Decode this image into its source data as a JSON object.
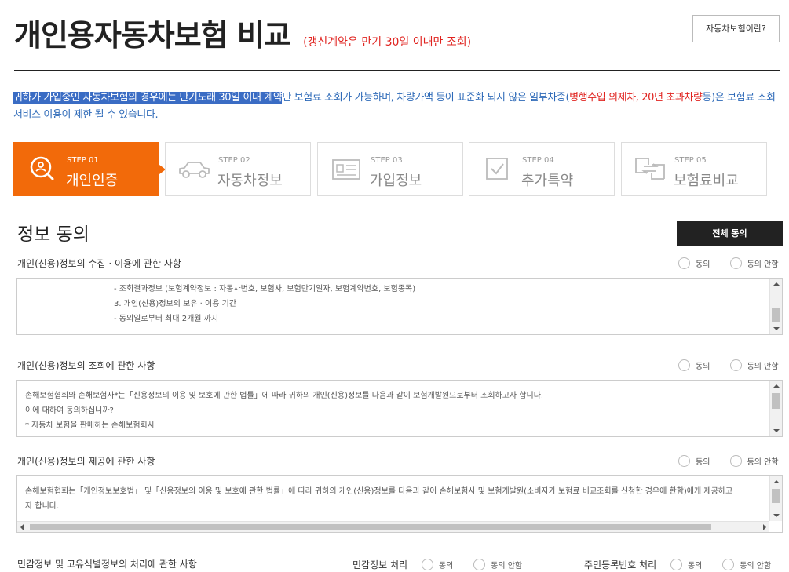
{
  "header": {
    "title": "개인용자동차보험 비교",
    "subtitle": "(갱신계약은 만기 30일 이내만 조회)",
    "about_button": "자동차보험이란?"
  },
  "notice": {
    "highlighted": "귀하가 가입중인 자동차보험의 경우에는 만기도래 30일 이내 계약",
    "part1": "만 보험료 조회가 가능하며, 차량가액 등이 표준화 되지 않은 일부차종(",
    "red": "병행수입 외제차, 20년 초과차량",
    "part2": "등)은 보험료 조회서비스 이용이 제한 될 수 있습니다."
  },
  "steps": [
    {
      "num": "STEP 01",
      "label": "개인인증",
      "icon": "search-person-icon",
      "active": true
    },
    {
      "num": "STEP 02",
      "label": "자동차정보",
      "icon": "car-icon",
      "active": false
    },
    {
      "num": "STEP 03",
      "label": "가입정보",
      "icon": "id-card-icon",
      "active": false
    },
    {
      "num": "STEP 04",
      "label": "추가특약",
      "icon": "checkbox-icon",
      "active": false
    },
    {
      "num": "STEP 05",
      "label": "보험료비교",
      "icon": "compare-arrows-icon",
      "active": false
    }
  ],
  "consent": {
    "title": "정보 동의",
    "agree_all": "전체 동의",
    "agree": "동의",
    "disagree": "동의 안함",
    "sections": [
      {
        "label": "개인(신용)정보의 수집 · 이용에 관한 사항",
        "lines": [
          "- 조회결과정보 (보험계약정보 : 자동차번호, 보험사, 보험만기일자, 보험계약번호, 보험종목)",
          "3. 개인(신용)정보의 보유 · 이용 기간",
          "- 동의일로부터 최대 2개월 까지"
        ]
      },
      {
        "label": "개인(신용)정보의 조회에 관한 사항",
        "lines": [
          "손해보험협회와 손해보험사*는「신용정보의 이용 및 보호에 관한 법률」에 따라 귀하의 개인(신용)정보를 다음과 같이 보험개발원으로부터 조회하고자 합니다.",
          "이에 대하여 동의하십니까?",
          "* 자동차 보험을 판매하는 손해보험회사"
        ]
      },
      {
        "label": "개인(신용)정보의 제공에 관한 사항",
        "lines": [
          "손해보험협회는「개인정보보호법」 및「신용정보의 이용 및 보호에 관한 법률」에 따라 귀하의 개인(신용)정보를 다음과 같이 손해보험사 및 보험개발원(소비자가 보험료 비교조회를 신청한 경우에 한함)에게 제공하고",
          "자 합니다."
        ]
      }
    ],
    "last_row": {
      "label": "민감정보 및 고유식별정보의 처리에 관한 사항",
      "sensitive_label": "민감정보 처리",
      "resident_label": "주민등록번호 처리"
    }
  }
}
